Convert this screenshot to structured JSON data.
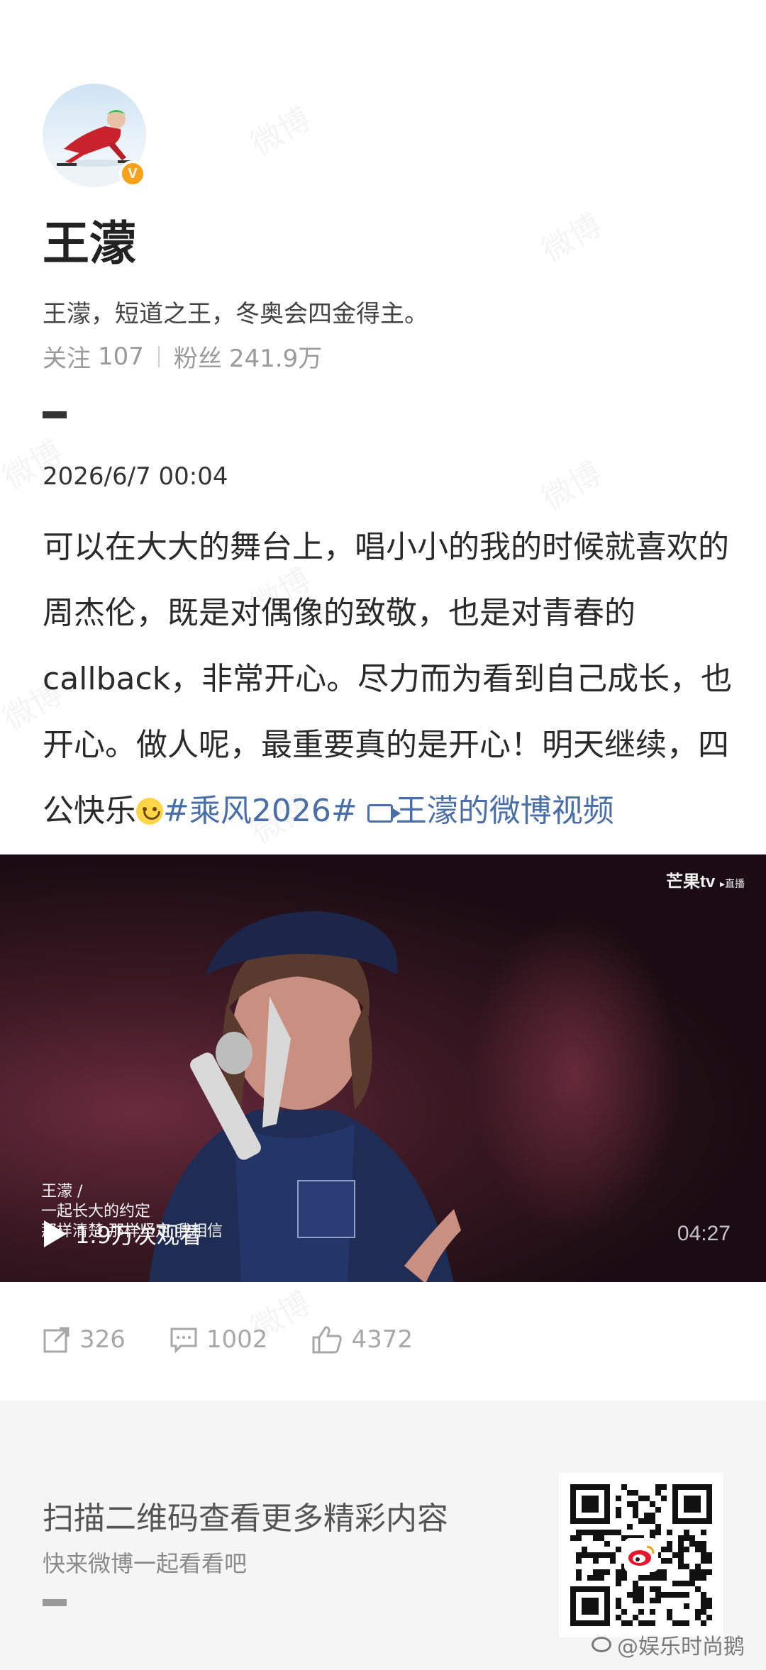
{
  "profile": {
    "name": "王濛",
    "verified_badge": "V",
    "bio": "王濛，短道之王，冬奥会四金得主。",
    "following_label": "关注",
    "following_count": "107",
    "followers_label": "粉丝",
    "followers_count": "241.9万"
  },
  "post": {
    "date": "2026/6/7 00:04",
    "text": "可以在大大的舞台上，唱小小的我的时候就喜欢的周杰伦，既是对偶像的致敬，也是对青春的callback，非常开心。尽力而为看到自己成长，也开心。做人呢，最重要真的是开心！明天继续，四公快乐",
    "hashtag": "#乘风2026#",
    "video_link": "王濛的微博视频"
  },
  "video": {
    "brand": "芒果tv",
    "brand_sub": "▸直播",
    "caption_line1": "王濛 /",
    "caption_line2": "一起长大的约定",
    "caption_line3": "那样清楚 那样坚定 我相信",
    "view_count": "1.9万次观看",
    "duration": "04:27"
  },
  "actions": {
    "repost_count": "326",
    "comment_count": "1002",
    "like_count": "4372"
  },
  "footer": {
    "title": "扫描二维码查看更多精彩内容",
    "subtitle": "快来微博一起看看吧",
    "credit": "@娱乐时尚鹅"
  },
  "watermark": "微博",
  "colors": {
    "link": "#4a6ea8",
    "verified": "#f7a21b"
  }
}
